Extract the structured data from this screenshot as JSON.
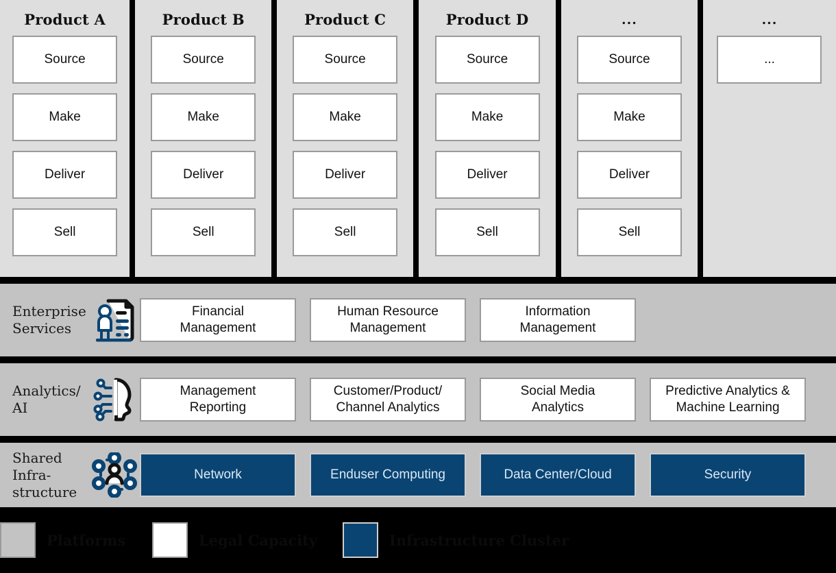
{
  "product_band": {
    "columns": [
      {
        "title": "Product A",
        "stages": [
          "Source",
          "Make",
          "Deliver",
          "Sell"
        ]
      },
      {
        "title": "Product B",
        "stages": [
          "Source",
          "Make",
          "Deliver",
          "Sell"
        ]
      },
      {
        "title": "Product C",
        "stages": [
          "Source",
          "Make",
          "Deliver",
          "Sell"
        ]
      },
      {
        "title": "Product D",
        "stages": [
          "Source",
          "Make",
          "Deliver",
          "Sell"
        ]
      },
      {
        "title": "...",
        "stages": [
          "Source",
          "Make",
          "Deliver",
          "Sell"
        ]
      },
      {
        "title": "...",
        "stages": [
          "..."
        ]
      }
    ]
  },
  "rows": [
    {
      "label_line1": "Enterprise",
      "label_line2": "Services",
      "icon": "person-document-icon",
      "style": "white",
      "items": [
        {
          "line1": "Financial",
          "line2": "Management"
        },
        {
          "line1": "Human Resource",
          "line2": "Management"
        },
        {
          "line1": "Information",
          "line2": "Management"
        }
      ]
    },
    {
      "label_line1": "Analytics/",
      "label_line2": "AI",
      "icon": "ai-head-circuit-icon",
      "style": "white",
      "items": [
        {
          "line1": "Management",
          "line2": "Reporting"
        },
        {
          "line1": "Customer/Product/",
          "line2": "Channel Analytics"
        },
        {
          "line1": "Social Media",
          "line2": "Analytics"
        },
        {
          "line1": "Predictive Analytics &",
          "line2": "Machine Learning"
        }
      ]
    },
    {
      "label_line1": "Shared",
      "label_line2": "Infra-",
      "label_line3": "structure",
      "icon": "network-person-icon",
      "style": "blue",
      "items": [
        {
          "line1": "Network",
          "line2": ""
        },
        {
          "line1": "Enduser Computing",
          "line2": ""
        },
        {
          "line1": "Data Center/Cloud",
          "line2": ""
        },
        {
          "line1": "Security",
          "line2": ""
        }
      ]
    }
  ],
  "legend": {
    "items": [
      {
        "label": "Platforms",
        "swatch": "gray"
      },
      {
        "label": "Legal Capacity",
        "swatch": "white"
      },
      {
        "label": "Infrastructure Cluster",
        "swatch": "blue"
      }
    ]
  },
  "colors": {
    "product_bg": "#dedede",
    "row_bg": "#c3c3c3",
    "box_border": "#9a9a9a",
    "accent_blue": "#0a4473",
    "blue_text": "#d9e9f5",
    "divider": "#000000"
  }
}
